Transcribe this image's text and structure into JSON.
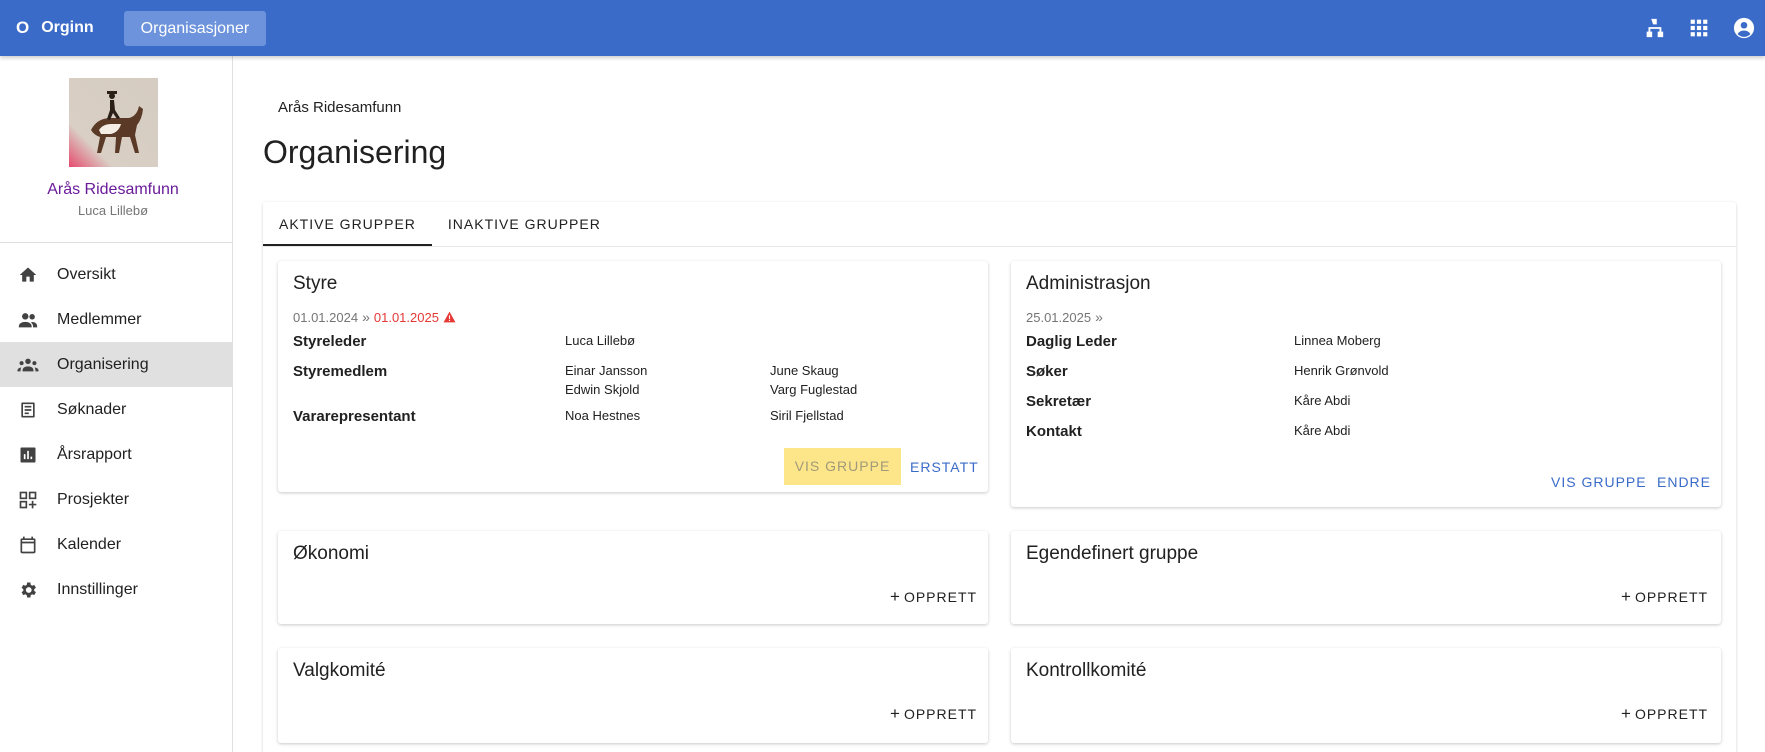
{
  "topbar": {
    "brand_mark": "O",
    "brand_name": "Orginn",
    "org_button": "Organisasjoner",
    "icons": [
      "sitemap-icon",
      "apps-grid-icon",
      "account-circle-icon"
    ]
  },
  "sidebar": {
    "org_name": "Arås Ridesamfunn",
    "user_name": "Luca Lillebø",
    "items": [
      {
        "label": "Oversikt",
        "icon": "home-icon",
        "active": false
      },
      {
        "label": "Medlemmer",
        "icon": "people-icon",
        "active": false
      },
      {
        "label": "Organisering",
        "icon": "groups-icon",
        "active": true
      },
      {
        "label": "Søknader",
        "icon": "document-icon",
        "active": false
      },
      {
        "label": "Årsrapport",
        "icon": "bar-chart-icon",
        "active": false
      },
      {
        "label": "Prosjekter",
        "icon": "add-grid-icon",
        "active": false
      },
      {
        "label": "Kalender",
        "icon": "calendar-icon",
        "active": false
      },
      {
        "label": "Innstillinger",
        "icon": "gear-icon",
        "active": false
      }
    ]
  },
  "main": {
    "breadcrumb": "Arås Ridesamfunn",
    "title": "Organisering",
    "tabs": [
      {
        "label": "AKTIVE GRUPPER",
        "active": true
      },
      {
        "label": "INAKTIVE GRUPPER",
        "active": false
      }
    ]
  },
  "cards": {
    "styre": {
      "title": "Styre",
      "date_start": "01.01.2024",
      "date_sep": "»",
      "date_end": "01.01.2025",
      "roles": {
        "leder_label": "Styreleder",
        "leder_members": [
          "Luca Lillebø"
        ],
        "medlem_label": "Styremedlem",
        "medlem_members": [
          "Einar Jansson",
          "Edwin Skjold",
          "June Skaug",
          "Varg Fuglestad"
        ],
        "vara_label": "Vararepresentant",
        "vara_members": [
          "Noa Hestnes",
          "Siril Fjellstad"
        ]
      },
      "btn_view": "VIS GRUPPE",
      "btn_replace": "ERSTATT"
    },
    "admin": {
      "title": "Administrasjon",
      "date_start": "25.01.2025",
      "date_sep": "»",
      "roles": [
        {
          "label": "Daglig Leder",
          "member": "Linnea Moberg"
        },
        {
          "label": "Søker",
          "member": "Henrik Grønvold"
        },
        {
          "label": "Sekretær",
          "member": "Kåre Abdi"
        },
        {
          "label": "Kontakt",
          "member": "Kåre Abdi"
        }
      ],
      "btn_view": "VIS GRUPPE",
      "btn_edit": "ENDRE"
    },
    "okonomi": {
      "title": "Økonomi",
      "btn_create": "OPPRETT"
    },
    "egendefinert": {
      "title": "Egendefinert gruppe",
      "btn_create": "OPPRETT"
    },
    "valgkomite": {
      "title": "Valgkomité",
      "btn_create": "OPPRETT"
    },
    "kontrollkomite": {
      "title": "Kontrollkomité",
      "btn_create": "OPPRETT"
    }
  },
  "colors": {
    "primary": "#3a6bc9",
    "org_name": "#6a1b9a",
    "warning": "#e53935",
    "highlight": "#fde68a"
  }
}
